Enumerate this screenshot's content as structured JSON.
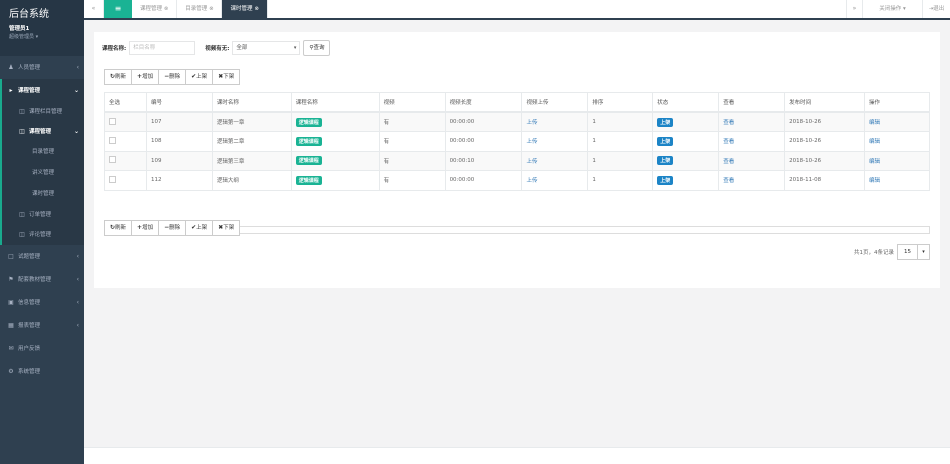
{
  "brand": {
    "title": "后台系统",
    "user": "管理员1",
    "role": "超级管理员 ▾"
  },
  "sidebar": {
    "items": [
      {
        "label": "人员管理",
        "icon": "group-icon"
      },
      {
        "label": "课程管理",
        "icon": "folder-icon"
      },
      {
        "label": "课程栏目管理",
        "icon": "list-icon"
      },
      {
        "label": "课程管理",
        "icon": "list-icon"
      },
      {
        "label": "目录管理"
      },
      {
        "label": "讲义管理"
      },
      {
        "label": "课时管理"
      },
      {
        "label": "订单管理",
        "icon": "list-icon"
      },
      {
        "label": "评论管理",
        "icon": "list-icon"
      },
      {
        "label": "试题管理",
        "icon": "book-icon"
      },
      {
        "label": "配套教材管理",
        "icon": "bookmark-icon"
      },
      {
        "label": "信息管理",
        "icon": "card-icon"
      },
      {
        "label": "报表管理",
        "icon": "chart-icon"
      },
      {
        "label": "用户反馈",
        "icon": "comment-icon"
      },
      {
        "label": "系统管理",
        "icon": "cogs-icon"
      }
    ]
  },
  "topbar": {
    "tabs": [
      {
        "label": "课程管理"
      },
      {
        "label": "目录管理"
      },
      {
        "label": "课时管理"
      }
    ],
    "close_ops": "关闭操作 ▾",
    "exit": "退出"
  },
  "search": {
    "name_label": "课程名称:",
    "name_placeholder": "栏目名称",
    "video_label": "视频有无:",
    "video_value": "全部",
    "query_button": "查询"
  },
  "toolbar": {
    "refresh": "刷新",
    "add": "增加",
    "delete": "删除",
    "up": "上架",
    "down": "下架"
  },
  "table": {
    "headers": [
      "全选",
      "编号",
      "课时名称",
      "课程名称",
      "视频",
      "视频长度",
      "视频上传",
      "排序",
      "状态",
      "查看",
      "发布时间",
      "操作"
    ],
    "rows": [
      {
        "id": "107",
        "name": "逻辑第一章",
        "course": "逻辑课程",
        "video": "有",
        "length": "00:00:00",
        "upload": "上传",
        "sort": "1",
        "status": "上架",
        "view": "查看",
        "date": "2018-10-26",
        "op": "编辑"
      },
      {
        "id": "108",
        "name": "逻辑第二章",
        "course": "逻辑课程",
        "video": "有",
        "length": "00:00:00",
        "upload": "上传",
        "sort": "1",
        "status": "上架",
        "view": "查看",
        "date": "2018-10-26",
        "op": "编辑"
      },
      {
        "id": "109",
        "name": "逻辑第三章",
        "course": "逻辑课程",
        "video": "有",
        "length": "00:00:10",
        "upload": "上传",
        "sort": "1",
        "status": "上架",
        "view": "查看",
        "date": "2018-10-26",
        "op": "编辑"
      },
      {
        "id": "112",
        "name": "逻辑大纲",
        "course": "逻辑课程",
        "video": "有",
        "length": "00:00:00",
        "upload": "上传",
        "sort": "1",
        "status": "上架",
        "view": "查看",
        "date": "2018-11-08",
        "op": "编辑"
      }
    ]
  },
  "pager": {
    "summary": "共1页，4条记录",
    "page_size": "15"
  },
  "colors": {
    "sidebar": "#2f4050",
    "accent": "#1ab394",
    "status": "#1c84c6"
  }
}
